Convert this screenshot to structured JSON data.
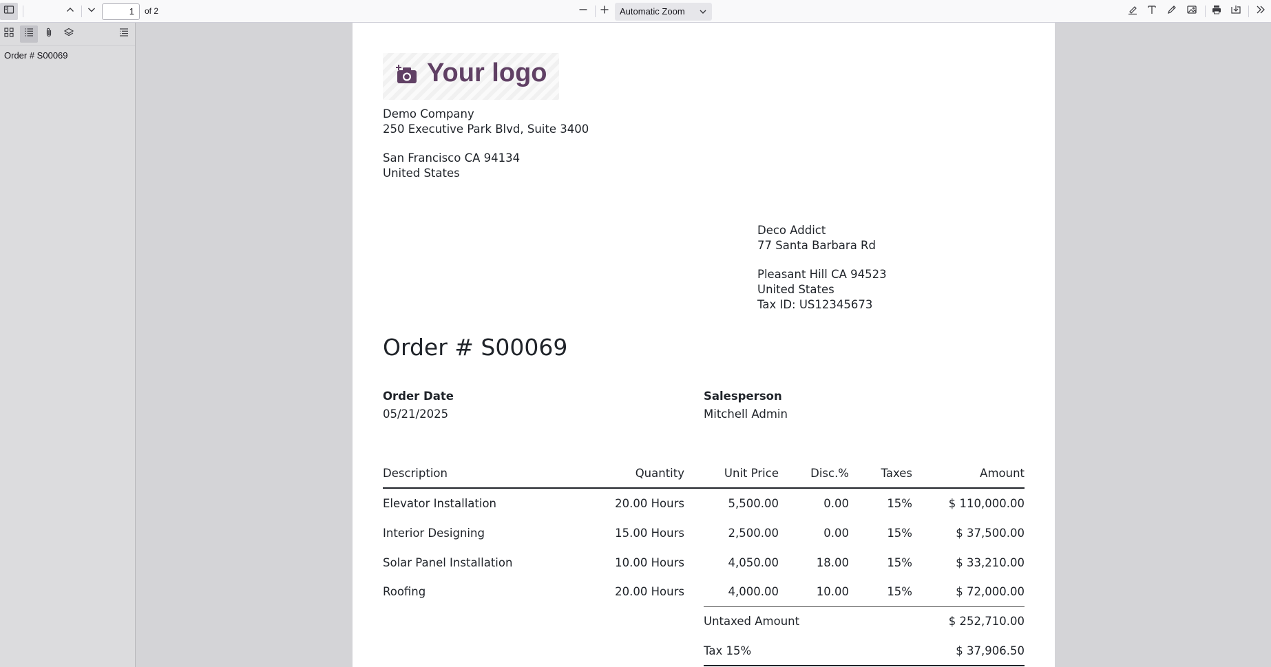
{
  "viewer": {
    "page_number": "1",
    "page_count_label": "of 2",
    "zoom_label": "Automatic Zoom"
  },
  "outline": {
    "items": [
      "Order # S00069"
    ]
  },
  "logo": {
    "text": "Your logo"
  },
  "company": {
    "name": "Demo Company",
    "street": "250 Executive Park Blvd, Suite 3400",
    "city": "San Francisco CA 94134",
    "country": "United States"
  },
  "customer": {
    "name": "Deco Addict",
    "street": "77 Santa Barbara Rd",
    "city": "Pleasant Hill CA 94523",
    "country": "United States",
    "tax_id": "Tax ID: US12345673"
  },
  "order": {
    "title": "Order # S00069",
    "date_label": "Order Date",
    "date_value": "05/21/2025",
    "salesperson_label": "Salesperson",
    "salesperson_value": "Mitchell Admin"
  },
  "table": {
    "headers": [
      "Description",
      "Quantity",
      "Unit Price",
      "Disc.%",
      "Taxes",
      "Amount"
    ],
    "rows": [
      [
        "Elevator Installation",
        "20.00 Hours",
        "5,500.00",
        "0.00",
        "15%",
        "$ 110,000.00"
      ],
      [
        "Interior Designing",
        "15.00 Hours",
        "2,500.00",
        "0.00",
        "15%",
        "$ 37,500.00"
      ],
      [
        "Solar Panel Installation",
        "10.00 Hours",
        "4,050.00",
        "18.00",
        "15%",
        "$ 33,210.00"
      ],
      [
        "Roofing",
        "20.00 Hours",
        "4,000.00",
        "10.00",
        "15%",
        "$ 72,000.00"
      ]
    ],
    "untaxed_label": "Untaxed Amount",
    "untaxed_value": "$ 252,710.00",
    "tax_label": "Tax 15%",
    "tax_value": "$ 37,906.50"
  }
}
